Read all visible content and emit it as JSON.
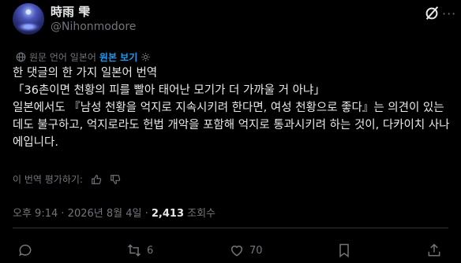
{
  "author": {
    "name": "時雨 雫",
    "handle": "@Nihonmodore"
  },
  "translation": {
    "notice": "원문 언어 일본어",
    "show_original": "원본 보기"
  },
  "post": {
    "lines": [
      "한 댓글의 한 가지 일본어 번역",
      "「36촌이면 천황의 피를 빨아 태어난 모기가 더 가까울 거 아냐」",
      "일본에서도 『남성 천황을 억지로 지속시키려 한다면, 여성 천황으로 좋다』는 의견이 있는 데도 불구하고, 억지로라도 헌법 개악을 포함해 억지로 통과시키려 하는 것이, 다카이치 사나에입니다."
    ]
  },
  "rate_translation": "이 번역 평가하기:",
  "meta": {
    "time": "오후 9:14",
    "sep": "·",
    "date": "2026년 8월 4일",
    "views_count": "2,413",
    "views_label": "조회수"
  },
  "actions": {
    "replies": "",
    "reposts": "6",
    "likes": "70",
    "bookmarks": "",
    "share": ""
  },
  "icons": [
    "grok-icon",
    "more-icon",
    "globe-icon",
    "gear-icon",
    "thumb-up-icon",
    "thumb-down-icon",
    "reply-icon",
    "repost-icon",
    "like-icon",
    "bookmark-icon",
    "share-icon"
  ],
  "colors": {
    "accent": "#1d9bf0",
    "muted": "#71767b",
    "text": "#e7e9ea",
    "bg": "#000000"
  }
}
